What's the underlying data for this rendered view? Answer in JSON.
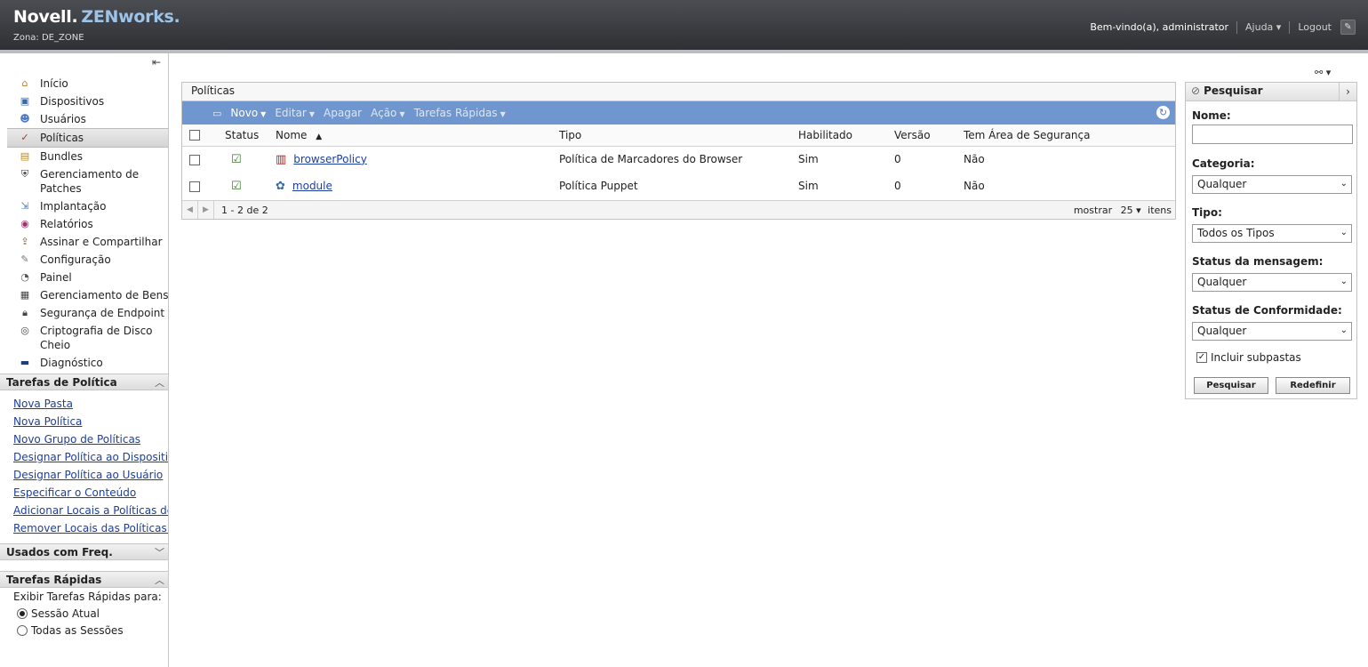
{
  "header": {
    "brand": "Novell.",
    "brand_product": "ZENworks.",
    "zone": "Zona: DE_ZONE",
    "welcome": "Bem-vindo(a), administrator",
    "help": "Ajuda",
    "logout": "Logout",
    "tool_icon": "wrench-icon"
  },
  "sidebar": {
    "nav": [
      {
        "label": "Início",
        "icon": "home-icon"
      },
      {
        "label": "Dispositivos",
        "icon": "computer-icon"
      },
      {
        "label": "Usuários",
        "icon": "users-icon"
      },
      {
        "label": "Políticas",
        "icon": "policy-icon"
      },
      {
        "label": "Bundles",
        "icon": "bundle-icon"
      },
      {
        "label": "Gerenciamento de Patches",
        "icon": "shield-icon"
      },
      {
        "label": "Implantação",
        "icon": "deploy-icon"
      },
      {
        "label": "Relatórios",
        "icon": "report-icon"
      },
      {
        "label": "Assinar e Compartilhar",
        "icon": "subscribe-icon"
      },
      {
        "label": "Configuração",
        "icon": "wrench-icon"
      },
      {
        "label": "Painel",
        "icon": "dashboard-icon"
      },
      {
        "label": "Gerenciamento de Bens",
        "icon": "assets-icon"
      },
      {
        "label": "Segurança de Endpoint",
        "icon": "lock-icon"
      },
      {
        "label": "Criptografia de Disco Cheio",
        "icon": "disk-icon"
      },
      {
        "label": "Diagnóstico",
        "icon": "diagnostic-icon"
      }
    ],
    "policy_tasks_title": "Tarefas de Política",
    "policy_tasks": [
      "Nova Pasta",
      "Nova Política",
      "Novo Grupo de Políticas",
      "Designar Política ao Dispositivo",
      "Designar Política ao Usuário",
      "Especificar o Conteúdo",
      "Adicionar Locais a Políticas de",
      "Remover Locais das Políticas de"
    ],
    "frequent_title": "Usados com Freq.",
    "quick_tasks_title": "Tarefas Rápidas",
    "quick_tasks_label": "Exibir Tarefas Rápidas para:",
    "radio_current": "Sessão Atual",
    "radio_all": "Todas as Sessões"
  },
  "grid": {
    "title": "Políticas",
    "toolbar": {
      "new": "Novo",
      "edit": "Editar",
      "delete": "Apagar",
      "action": "Ação",
      "quick_tasks": "Tarefas Rápidas"
    },
    "columns": {
      "status": "Status",
      "name": "Nome",
      "type": "Tipo",
      "enabled": "Habilitado",
      "version": "Versão",
      "sandbox": "Tem Área de Segurança"
    },
    "rows": [
      {
        "name": "browserPolicy",
        "type": "Política de Marcadores do Browser",
        "enabled": "Sim",
        "version": "0",
        "sandbox": "Não"
      },
      {
        "name": "module",
        "type": "Política Puppet",
        "enabled": "Sim",
        "version": "0",
        "sandbox": "Não"
      }
    ],
    "footer": {
      "range": "1 - 2 de 2",
      "show": "mostrar",
      "page_size": "25",
      "items": "itens"
    }
  },
  "search": {
    "title": "Pesquisar",
    "name_label": "Nome:",
    "name_value": "",
    "category_label": "Categoria:",
    "category_value": "Qualquer",
    "type_label": "Tipo:",
    "type_value": "Todos os Tipos",
    "msg_status_label": "Status da mensagem:",
    "msg_status_value": "Qualquer",
    "compliance_label": "Status de Conformidade:",
    "compliance_value": "Qualquer",
    "include_subfolders": "Incluir subpastas",
    "search_btn": "Pesquisar",
    "reset_btn": "Redefinir"
  }
}
